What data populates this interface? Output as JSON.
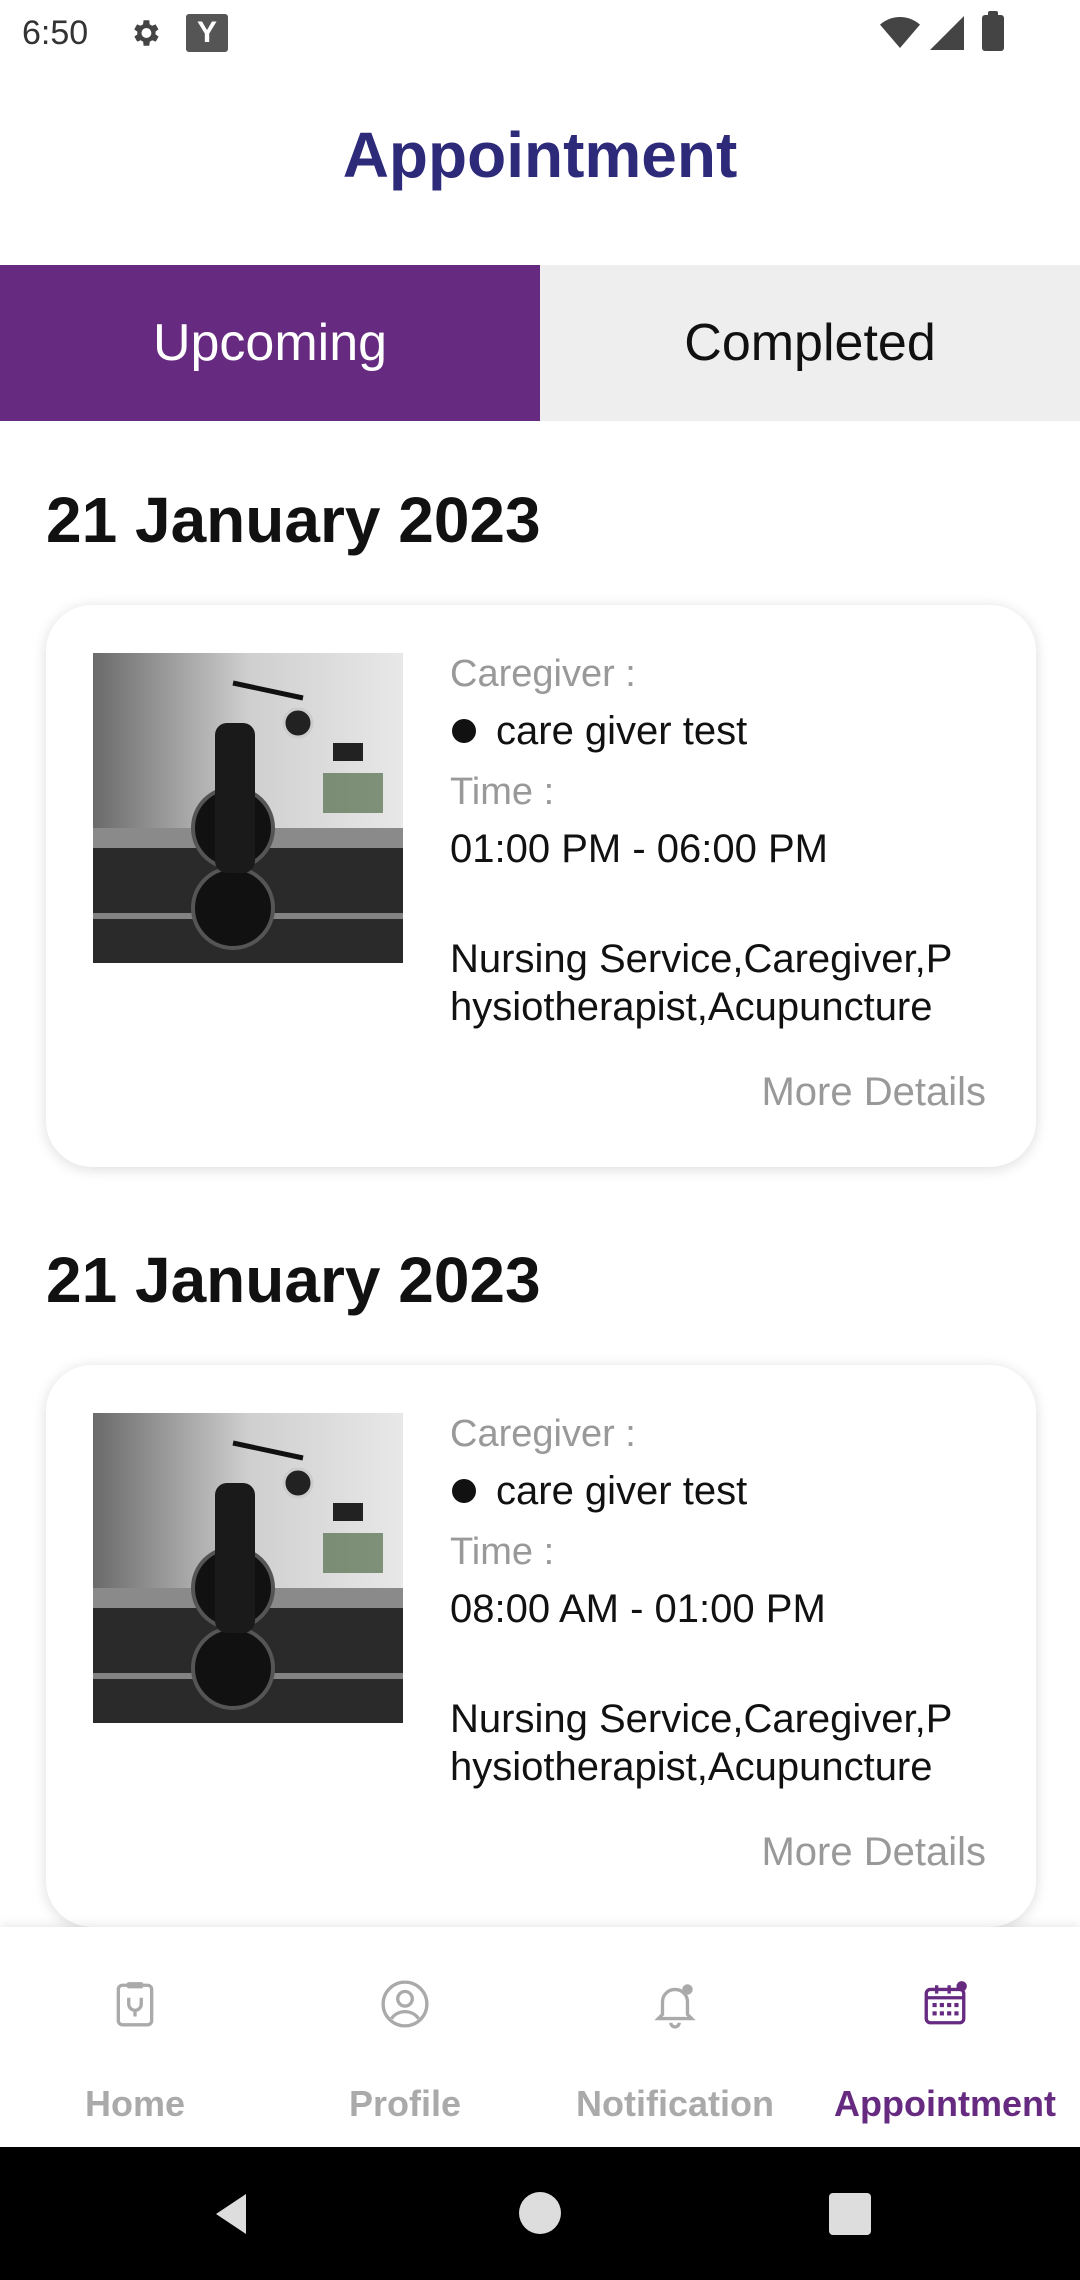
{
  "status_bar": {
    "time": "6:50",
    "icons": [
      "gear-icon",
      "y-app-icon",
      "wifi-icon",
      "signal-icon",
      "battery-icon"
    ],
    "y_badge": "Y"
  },
  "header": {
    "title": "Appointment"
  },
  "tabs": [
    {
      "label": "Upcoming",
      "active": true
    },
    {
      "label": "Completed",
      "active": false
    }
  ],
  "appointments": [
    {
      "date": "21 January 2023",
      "caregiver_label": "Caregiver :",
      "caregiver_name": "care giver test",
      "time_label": "Time :",
      "time": "01:00 PM - 06:00 PM",
      "services": "Nursing Service,Caregiver,Physiotherapist,Acupuncture",
      "more_details": "More Details"
    },
    {
      "date": "21 January 2023",
      "caregiver_label": "Caregiver :",
      "caregiver_name": "care giver test",
      "time_label": "Time :",
      "time": "08:00 AM - 01:00 PM",
      "services": "Nursing Service,Caregiver,Physiotherapist,Acupuncture",
      "more_details": "More Details"
    }
  ],
  "bottom_nav": [
    {
      "label": "Home",
      "icon": "clipboard-stethoscope-icon",
      "active": false
    },
    {
      "label": "Profile",
      "icon": "user-circle-icon",
      "active": false
    },
    {
      "label": "Notification",
      "icon": "bell-icon",
      "active": false
    },
    {
      "label": "Appointment",
      "icon": "calendar-icon",
      "active": true
    }
  ],
  "colors": {
    "accent": "#662a80",
    "title": "#2e2a7a",
    "inactive_tab": "#eeeeee",
    "muted_text": "#999999"
  }
}
